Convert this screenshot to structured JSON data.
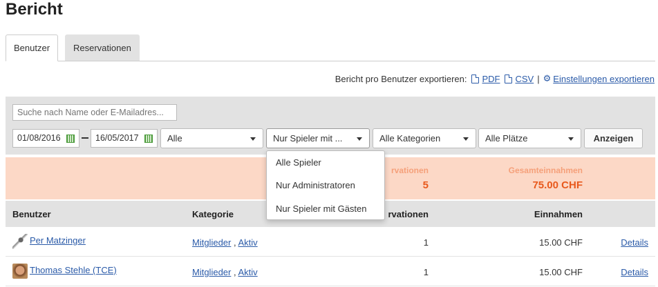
{
  "page": {
    "title": "Bericht"
  },
  "tabs": [
    {
      "label": "Benutzer",
      "active": true
    },
    {
      "label": "Reservationen",
      "active": false
    }
  ],
  "export": {
    "label": "Bericht pro Benutzer exportieren:",
    "pdf": "PDF",
    "csv": "CSV",
    "separator": "|",
    "settings": "Einstellungen exportieren"
  },
  "filters": {
    "search_placeholder": "Suche nach Name oder E-Mailadres...",
    "date_from": "01/08/2016",
    "date_to": "16/05/2017",
    "status_select": "Alle",
    "player_select": "Nur Spieler mit ...",
    "category_select": "Alle Kategorien",
    "court_select": "Alle Plätze",
    "show_button": "Anzeigen"
  },
  "dropdown": {
    "options": [
      "Alle Spieler",
      "Nur Administratoren",
      "Nur Spieler mit Gästen"
    ]
  },
  "summary": {
    "reservations_label": "rvationen",
    "reservations_value": "5",
    "income_label": "Gesamteinnahmen",
    "income_value": "75.00 CHF"
  },
  "table": {
    "headers": {
      "user": "Benutzer",
      "category": "Kategorie",
      "reservations": "rvationen",
      "income": "Einnahmen"
    },
    "rows": [
      {
        "name": "Per Matzinger",
        "cat1": "Mitglieder",
        "cat2": "Aktiv",
        "reservations": "1",
        "income": "15.00 CHF",
        "details": "Details"
      },
      {
        "name": "Thomas Stehle (TCE)",
        "cat1": "Mitglieder",
        "cat2": "Aktiv",
        "reservations": "1",
        "income": "15.00 CHF",
        "details": "Details"
      }
    ]
  },
  "colors": {
    "link": "#2a5aa8",
    "summary_bg": "#fcd8c6",
    "summary_value": "#e8591c",
    "panel_bg": "#e2e2e2"
  }
}
